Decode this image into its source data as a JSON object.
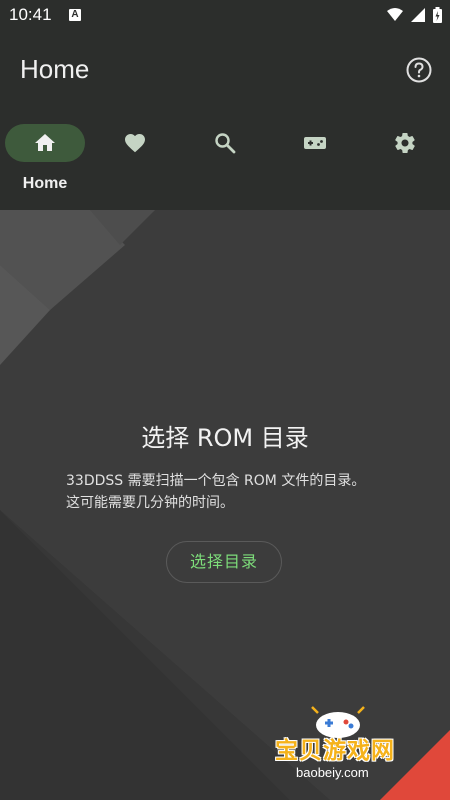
{
  "status_bar": {
    "time": "10:41",
    "notification_letter": "A"
  },
  "header": {
    "title": "Home"
  },
  "tabs": [
    {
      "label": "Home",
      "icon": "home-icon",
      "selected": true
    },
    {
      "label": "",
      "icon": "heart-icon",
      "selected": false
    },
    {
      "label": "",
      "icon": "search-icon",
      "selected": false
    },
    {
      "label": "",
      "icon": "gamepad-icon",
      "selected": false
    },
    {
      "label": "",
      "icon": "gear-icon",
      "selected": false
    }
  ],
  "main": {
    "title": "选择 ROM 目录",
    "description_line1": "33DDSS 需要扫描一个包含 ROM 文件的目录。",
    "description_line2": "这可能需要几分钟的时间。",
    "button_label": "选择目录"
  },
  "watermark": {
    "text": "宝贝游戏网",
    "url": "baobeiy.com"
  },
  "colors": {
    "app_bar": "#2c2e2c",
    "selected_tab": "#3e5a3c",
    "accent_green": "#7ddc7a",
    "watermark_orange": "#f5b21a",
    "corner_red": "#e0483a"
  }
}
